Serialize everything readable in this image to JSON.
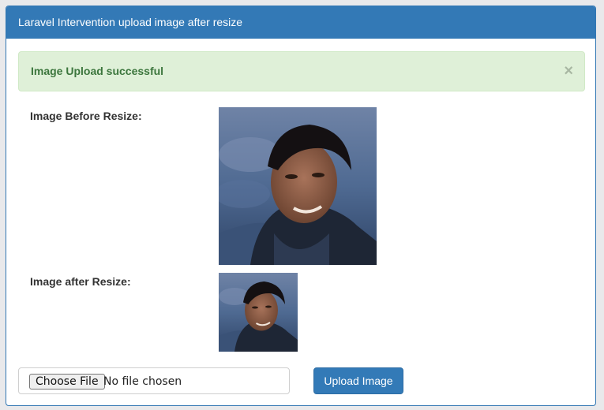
{
  "panel": {
    "title": "Laravel Intervention upload image after resize"
  },
  "alert": {
    "message": "Image Upload successful",
    "close_glyph": "×"
  },
  "images": {
    "before_label": "Image Before Resize:",
    "after_label": "Image after Resize:"
  },
  "form": {
    "choose_file_label": "Choose File",
    "file_status": "No file chosen",
    "upload_label": "Upload Image"
  },
  "colors": {
    "primary": "#337ab7",
    "success_bg": "#dff0d8",
    "success_text": "#3c763d"
  }
}
